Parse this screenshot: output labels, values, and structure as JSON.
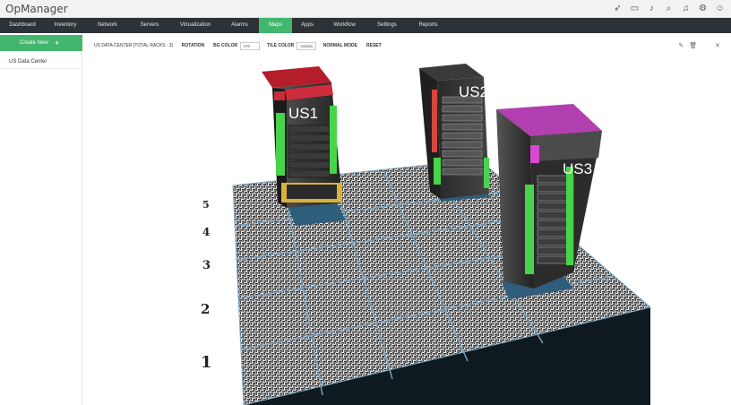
{
  "app": {
    "title": "OpManager"
  },
  "nav": {
    "items": [
      "Dashboard",
      "Inventory",
      "Network",
      "Servers",
      "Virtualization",
      "Alarms",
      "Maps",
      "Apps",
      "Workflow",
      "Settings",
      "Reports"
    ],
    "active": "Maps"
  },
  "sidebar": {
    "create_label": "Create New",
    "items": [
      "US Data Center"
    ]
  },
  "toolbar": {
    "title": "US DATA CENTER [TOTAL RACKS : 3]",
    "rotation_label": "ROTATION",
    "bg_color_label": "BG COLOR",
    "bg_color_value": "FFF",
    "tile_color_label": "TILE COLOR",
    "tile_color_value": "333333",
    "normal_mode_label": "NORMAL MODE",
    "reset_label": "RESET"
  },
  "floor": {
    "row_labels": [
      "5",
      "4",
      "3",
      "2",
      "1"
    ]
  },
  "racks": [
    {
      "name": "US1",
      "top_color": "#b51d2a"
    },
    {
      "name": "US2",
      "top_color": "#3a3a3a"
    },
    {
      "name": "US3",
      "top_color": "#b23fb0"
    }
  ],
  "colors": {
    "accent": "#43b66e",
    "nav_bg": "#2d3236"
  }
}
